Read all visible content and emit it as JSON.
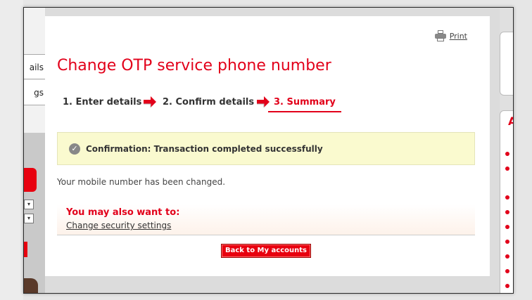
{
  "left_nav": {
    "items": [
      "ails",
      "gs"
    ]
  },
  "print": {
    "label": "Print",
    "icon": "printer-icon"
  },
  "page": {
    "title": "Change OTP service phone number"
  },
  "steps": [
    {
      "label": "1. Enter details",
      "state": "done"
    },
    {
      "label": "2. Confirm details",
      "state": "done"
    },
    {
      "label": "3. Summary",
      "state": "active"
    }
  ],
  "confirmation": {
    "icon": "check-circle-icon",
    "text": "Confirmation: Transaction completed successfully"
  },
  "result": {
    "text": "Your mobile number has been changed."
  },
  "also": {
    "heading": "You may also want to:",
    "link": "Change security settings"
  },
  "actions": {
    "back_label": "Back to My accounts"
  },
  "right_panel": {
    "letter": "A"
  },
  "colors": {
    "accent": "#e2001a",
    "confirm_bg": "#fafacf"
  }
}
